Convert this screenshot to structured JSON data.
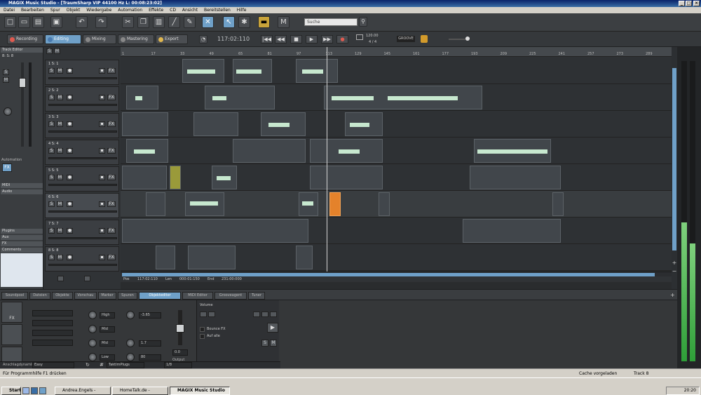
{
  "window": {
    "title": "MAGIX Music Studio - [TraumSharp VIP  44100 Hz L: 00:08:23:02]",
    "buttons": [
      "_",
      "□",
      "×"
    ]
  },
  "menu": [
    "Datei",
    "Bearbeiten",
    "Spur",
    "Objekt",
    "Wiedergabe",
    "Automation",
    "Effekte",
    "CD",
    "Ansicht",
    "Bereitstellen",
    "Hilfe"
  ],
  "toolbar": {
    "search_placeholder": "Suche"
  },
  "modes": [
    {
      "label": "Recording",
      "active": false,
      "dot": "#e05a4f"
    },
    {
      "label": "Editing",
      "active": true,
      "dot": "#4a7bb0"
    },
    {
      "label": "Mixing",
      "active": false,
      "dot": "#888"
    },
    {
      "label": "Mastering",
      "active": false,
      "dot": "#888"
    },
    {
      "label": "Export",
      "active": false,
      "dot": "#e0b74f"
    }
  ],
  "transport": {
    "timecode": "117:02:110",
    "tempo": "120.00",
    "meter": "4 / 4",
    "buttons": [
      "|◀◀",
      "◀◀",
      "■",
      "▶",
      "▶▶",
      "●"
    ],
    "preset": "GROOVE"
  },
  "left_panel": {
    "title": "Track Editor",
    "track_name": "8: S: 8",
    "automation_label": "Automation",
    "fx_button": "FX",
    "sections": [
      "MIDI",
      "Audio",
      "Plugins",
      "Aux",
      "FX",
      "Comments"
    ]
  },
  "tracks": [
    {
      "label": "1  S: 1"
    },
    {
      "label": "2  S: 2"
    },
    {
      "label": "3  S: 3"
    },
    {
      "label": "4  S: 4"
    },
    {
      "label": "5  S: 5"
    },
    {
      "label": "6  S: 6"
    },
    {
      "label": "7  S: 7"
    },
    {
      "label": "8  S: 8"
    }
  ],
  "track_buttons": {
    "solo": "S",
    "mute": "M",
    "fx": "FX"
  },
  "ruler_ticks": [
    "1",
    "17",
    "33",
    "49",
    "65",
    "81",
    "97",
    "113",
    "129",
    "145",
    "161",
    "177",
    "193",
    "209",
    "225",
    "241",
    "257",
    "273",
    "289"
  ],
  "arrange_status": {
    "pos_label": "Pos",
    "pos_value": "117:02:110",
    "len_label": "Len",
    "len_value": "000:01:150",
    "end_label": "End",
    "end_value": "231:00:000"
  },
  "bottom_tabs": [
    "Soundpool",
    "Dateien",
    "Objekte",
    "Vorschau",
    "Marker",
    "Spuren",
    "Objekteditor",
    "MIDI Editor",
    "Grooveagent",
    "Tuner"
  ],
  "bottom_active_tab": "Objekteditor",
  "eq": {
    "bands": [
      "High",
      "Mid",
      "Mid",
      "Low"
    ],
    "gain_value": "-3.65",
    "freq_value": "1.7",
    "q_value": "80",
    "output_value": "0.0",
    "output_label": "Output"
  },
  "obj_panel": {
    "title": "Volume",
    "bounce_label": "Bounce FX",
    "apply_label": "Auf alle"
  },
  "grid": {
    "label": "TaktImPlugs",
    "value": "1/8"
  },
  "keyboard_field": {
    "label": "Anschlagdynamik",
    "value": "Easy"
  },
  "status": {
    "help": "Für Programmhilfe F1 drücken",
    "cache": "Cache vorgeladen",
    "track": "Track 8"
  },
  "taskbar": {
    "start": "Start",
    "tasks": [
      {
        "label": "Andrea.Engels - Windows ...",
        "active": false
      },
      {
        "label": "HomeTalk.de - Windows I...",
        "active": false
      },
      {
        "label": "MAGIX Music Studio ...",
        "active": true
      }
    ],
    "clock": "20:20"
  },
  "colors": {
    "accent": "#6fa0c8",
    "wave": "#c7e8cf",
    "selected_clip": "#e4822b"
  }
}
